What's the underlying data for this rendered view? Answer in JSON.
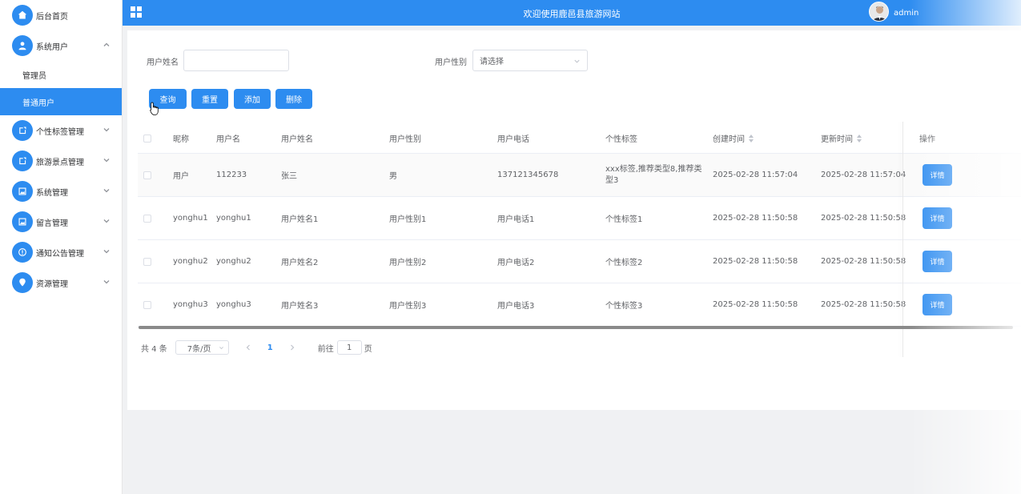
{
  "sidebar": {
    "items": [
      {
        "label": "后台首页",
        "icon": "home-icon"
      },
      {
        "label": "系统用户",
        "icon": "user-icon",
        "expanded": true,
        "children": [
          {
            "label": "管理员"
          },
          {
            "label": "普通用户",
            "active": true
          }
        ]
      },
      {
        "label": "个性标签管理",
        "icon": "edit-icon"
      },
      {
        "label": "旅游景点管理",
        "icon": "edit-icon"
      },
      {
        "label": "系统管理",
        "icon": "picture-icon"
      },
      {
        "label": "留言管理",
        "icon": "picture-icon"
      },
      {
        "label": "通知公告管理",
        "icon": "info-icon"
      },
      {
        "label": "资源管理",
        "icon": "location-icon"
      }
    ]
  },
  "header": {
    "title": "欢迎使用鹿邑县旅游网站",
    "username": "admin"
  },
  "filters": {
    "name_label": "用户姓名",
    "name_value": "",
    "gender_label": "用户性别",
    "gender_placeholder": "请选择"
  },
  "buttons": {
    "search": "查询",
    "reset": "重置",
    "add": "添加",
    "delete": "删除"
  },
  "table": {
    "columns": [
      "昵称",
      "用户名",
      "用户姓名",
      "用户性别",
      "用户电话",
      "个性标签",
      "创建时间",
      "更新时间",
      "操作"
    ],
    "rows": [
      {
        "nickname": "用户",
        "username": "112233",
        "realname": "张三",
        "gender": "男",
        "phone": "137121345678",
        "tags": "xxx标签,推荐类型8,推荐类型3",
        "created": "2025-02-28 11:57:04",
        "updated": "2025-02-28 11:57:04",
        "action": "详情"
      },
      {
        "nickname": "yonghu1",
        "username": "yonghu1",
        "realname": "用户姓名1",
        "gender": "用户性别1",
        "phone": "用户电话1",
        "tags": "个性标签1",
        "created": "2025-02-28 11:50:58",
        "updated": "2025-02-28 11:50:58",
        "action": "详情"
      },
      {
        "nickname": "yonghu2",
        "username": "yonghu2",
        "realname": "用户姓名2",
        "gender": "用户性别2",
        "phone": "用户电话2",
        "tags": "个性标签2",
        "created": "2025-02-28 11:50:58",
        "updated": "2025-02-28 11:50:58",
        "action": "详情"
      },
      {
        "nickname": "yonghu3",
        "username": "yonghu3",
        "realname": "用户姓名3",
        "gender": "用户性别3",
        "phone": "用户电话3",
        "tags": "个性标签3",
        "created": "2025-02-28 11:50:58",
        "updated": "2025-02-28 11:50:58",
        "action": "详情"
      }
    ]
  },
  "pagination": {
    "total": "共 4 条",
    "page_size": "7条/页",
    "current_page": "1",
    "goto_label": "前往",
    "goto_value": "1",
    "page_suffix": "页"
  },
  "colors": {
    "primary": "#2d8cf0",
    "background": "#f0f1f3"
  }
}
